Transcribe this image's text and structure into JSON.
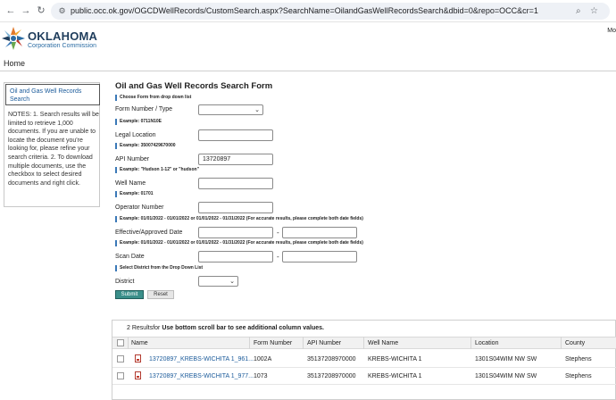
{
  "browser": {
    "url": "public.occ.ok.gov/OGCDWellRecords/CustomSearch.aspx?SearchName=OilandGasWellRecordsSearch&dbid=0&repo=OCC&cr=1",
    "icons": [
      "back-arrow-icon",
      "forward-arrow-icon",
      "reload-icon",
      "site-info-icon",
      "zoom-icon",
      "star-icon"
    ]
  },
  "header": {
    "title": "OKLAHOMA",
    "subtitle": "Corporation Commission",
    "more": "Mo"
  },
  "nav": {
    "home": "Home"
  },
  "sidebar": {
    "title": "Oil and Gas Well Records Search",
    "notes": "NOTES: 1. Search results will be limited to retrieve 1,000 documents. If you are unable to locate the document you're looking for, please refine your search criteria. 2. To download multiple documents, use the checkbox to select desired documents and right click."
  },
  "form": {
    "title": "Oil and Gas Well Records Search Form",
    "hint_form": "Choose Form from drop down list",
    "form_number_label": "Form Number / Type",
    "form_number_value": "",
    "hint_legal": "Example: 0711N10E",
    "legal_label": "Legal Location",
    "legal_value": "",
    "hint_api": "Example: 35007429670000",
    "api_label": "API Number",
    "api_value": "13720897",
    "hint_well": "Example: \"Hudson 1-12\" or \"hudson\"",
    "well_label": "Well Name",
    "well_value": "",
    "hint_operator": "Example: 01701",
    "operator_label": "Operator Number",
    "operator_value": "",
    "hint_eff": "Example: 01/01/2022 - 01/01/2022 or 01/01/2022 - 01/31/2022 (For accurate results, please complete both date fields)",
    "eff_label": "Effective/Approved Date",
    "eff_from": "",
    "eff_to": "",
    "hint_scan": "Example: 01/01/2022 - 01/01/2022 or 01/01/2022 - 01/31/2022 (For accurate results, please complete both date fields)",
    "scan_label": "Scan Date",
    "scan_from": "",
    "scan_to": "",
    "hint_district": "Select District from the Drop Down List",
    "district_label": "District",
    "district_value": "",
    "range_sep": "-",
    "submit": "Submit",
    "reset": "Reset"
  },
  "results": {
    "count": "2",
    "count_suffix": "Resultsfor",
    "instruction": "Use bottom scroll bar to see additional column values.",
    "columns": [
      "Name",
      "Form Number",
      "API Number",
      "Well Name",
      "Location",
      "County"
    ],
    "rows": [
      {
        "name": "13720897_KREBS-WICHITA 1_961...",
        "form": "1002A",
        "api": "35137208970000",
        "well": "KREBS-WICHITA 1",
        "location": "1301S04WIM NW SW",
        "county": "Stephens"
      },
      {
        "name": "13720897_KREBS-WICHITA 1_977...",
        "form": "1073",
        "api": "35137208970000",
        "well": "KREBS-WICHITA 1",
        "location": "1301S04WIM NW SW",
        "county": "Stephens"
      }
    ]
  },
  "colors": {
    "accent_blue": "#3b79b8",
    "submit_green": "#3a8f8a",
    "link_blue": "#1a5a9a"
  }
}
